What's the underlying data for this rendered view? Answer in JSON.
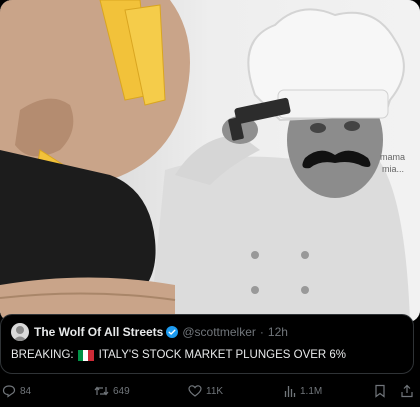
{
  "media": {
    "caption_line1": "mama",
    "caption_line2": "mia..."
  },
  "quoted_tweet": {
    "author_name": "The Wolf Of All Streets",
    "handle": "@scottmelker",
    "separator": "·",
    "time": "12h",
    "text_prefix": "BREAKING:",
    "text_body": "ITALY'S STOCK MARKET PLUNGES OVER 6%",
    "flag_colors": [
      "#009246",
      "#ffffff",
      "#ce2b37"
    ],
    "verified_color": "#1d9bf0"
  },
  "actions": {
    "replies": "84",
    "reposts": "649",
    "likes": "11K",
    "views": "1.1M"
  }
}
